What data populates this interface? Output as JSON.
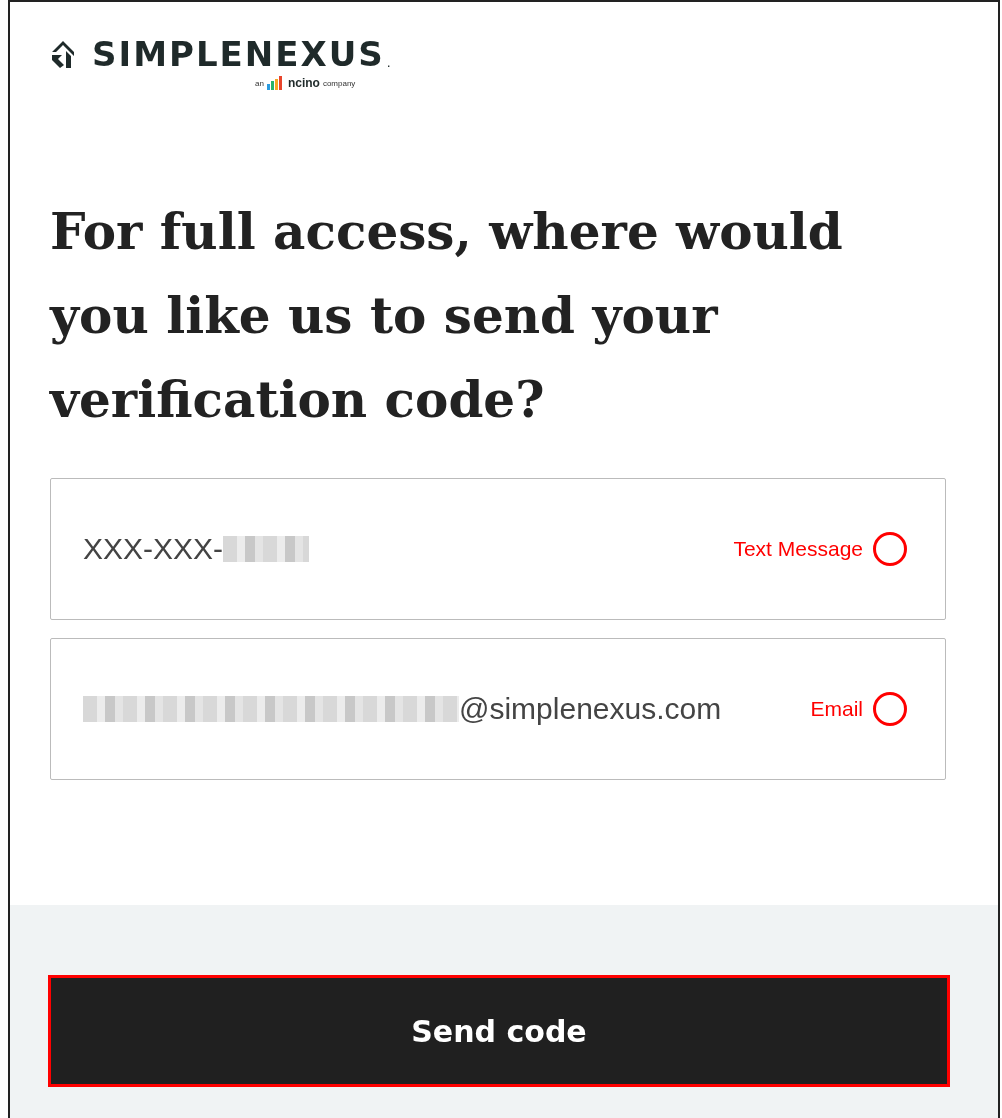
{
  "logo": {
    "brand": "SIMPLENEXUS",
    "brand_mark": ".",
    "tagline_prefix": "an",
    "partner": "ncino",
    "tagline_suffix": "company"
  },
  "heading": "For full access, where would you like us to send your verification code?",
  "options": [
    {
      "kind": "phone",
      "value": "XXX-XXX-",
      "label": "Text Message",
      "selected": false
    },
    {
      "kind": "email",
      "value": "@simplenexus.com",
      "label": "Email",
      "selected": false
    }
  ],
  "submit": "Send code"
}
